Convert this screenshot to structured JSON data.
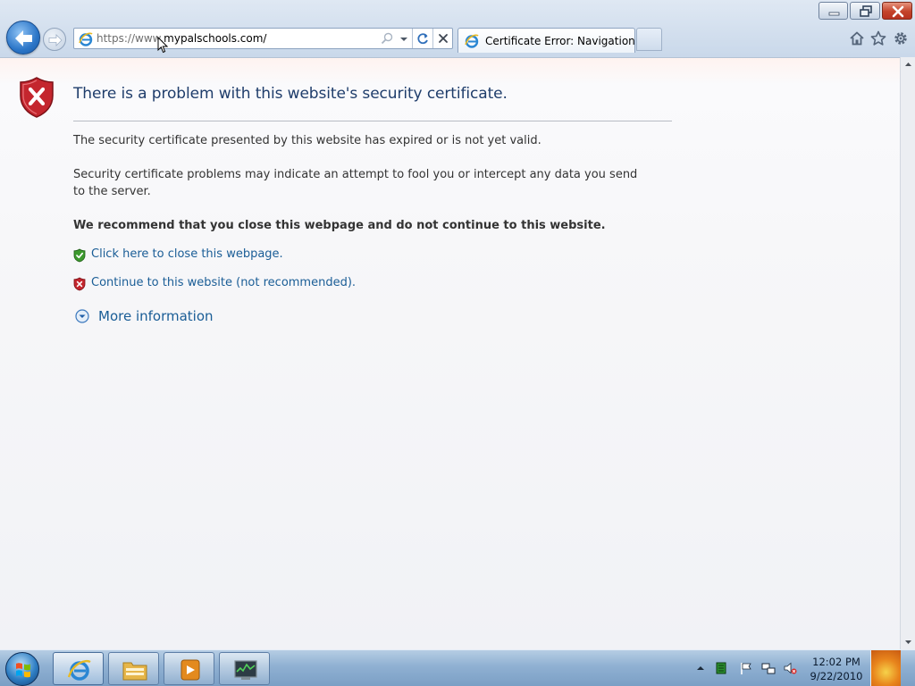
{
  "window": {
    "title_controls": [
      "minimize",
      "maximize",
      "close"
    ]
  },
  "address_bar": {
    "url_prefix": "https://www.",
    "url_host": "mypalschools.com/",
    "icons": [
      "ie-page-icon",
      "search-icon",
      "dropdown-arrow-icon",
      "refresh-icon",
      "stop-icon"
    ]
  },
  "tabs": [
    {
      "label": "Certificate Error: Navigation ...",
      "active": true
    }
  ],
  "command_icons": [
    "home-icon",
    "favorites-star-icon",
    "tools-gear-icon"
  ],
  "page": {
    "headline": "There is a problem with this website's security certificate.",
    "paragraph_1": "The security certificate presented by this website has expired or is not yet valid.",
    "paragraph_2": "Security certificate problems may indicate an attempt to fool you or intercept any data you send to the server.",
    "recommendation": "We recommend that you close this webpage and do not continue to this website.",
    "close_link": "Click here to close this webpage.",
    "continue_link": "Continue to this website (not recommended).",
    "more_info": "More information"
  },
  "taskbar": {
    "pinned": [
      "internet-explorer",
      "windows-explorer",
      "media-player",
      "task-manager"
    ],
    "tray_icons": [
      "show-hidden-icons-arrow",
      "green-app-icon",
      "action-center-flag-icon",
      "network-icon",
      "volume-muted-icon"
    ],
    "clock": {
      "time": "12:02 PM",
      "date": "9/22/2010"
    }
  },
  "colors": {
    "headline": "#1f3d6b",
    "link": "#1a5d96",
    "text": "#333333",
    "error_red": "#c4262e",
    "safe_green": "#3c9a2e"
  }
}
